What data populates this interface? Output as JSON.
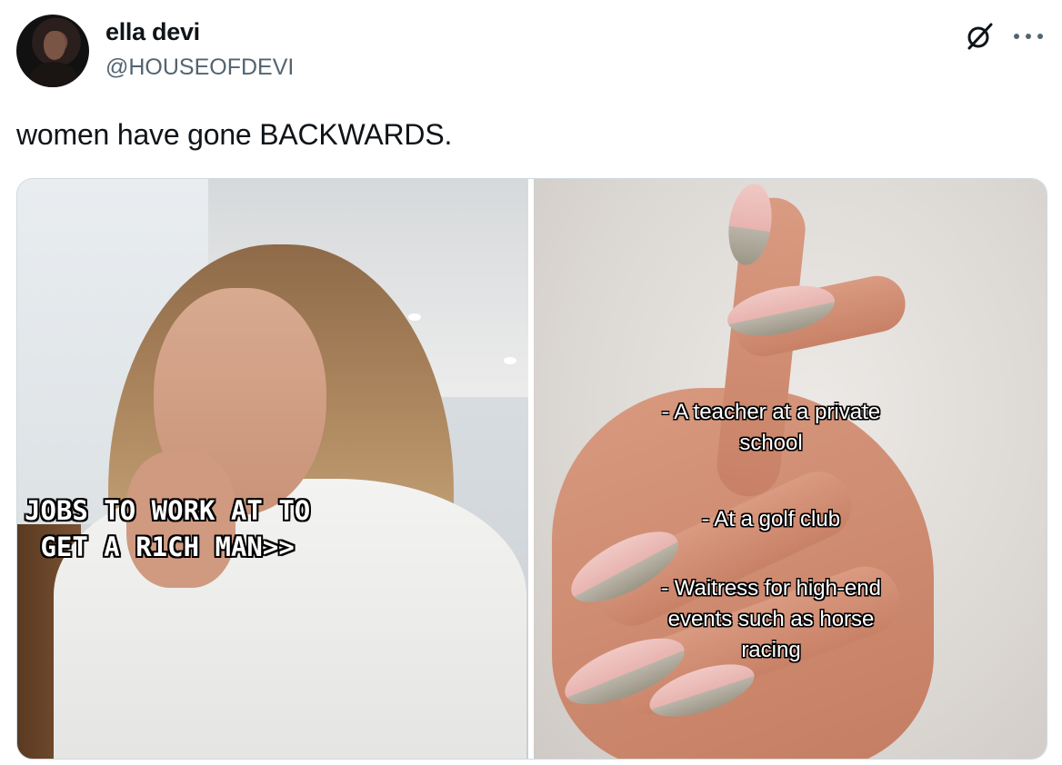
{
  "author": {
    "display_name": "ella devi",
    "handle": "@HOUSEOFDEVI"
  },
  "tweet": {
    "text": "women have gone BACKWARDS."
  },
  "icons": {
    "grok": "grok-icon",
    "more": "more-icon"
  },
  "media": {
    "left_panel": {
      "caption_line1": "JOBS TO WORK AT TO",
      "caption_line2": "GET A R1CH MAN>>"
    },
    "right_panel": {
      "item1_line1": "- A teacher at a private",
      "item1_line2": "school",
      "item2_line1": "- At a golf club",
      "item3_line1": "- Waitress for high-end",
      "item3_line2": "events such as horse",
      "item3_line3": "racing"
    }
  },
  "colors": {
    "text_primary": "#0f1419",
    "text_secondary": "#536471",
    "media_border": "#cfd9de"
  }
}
